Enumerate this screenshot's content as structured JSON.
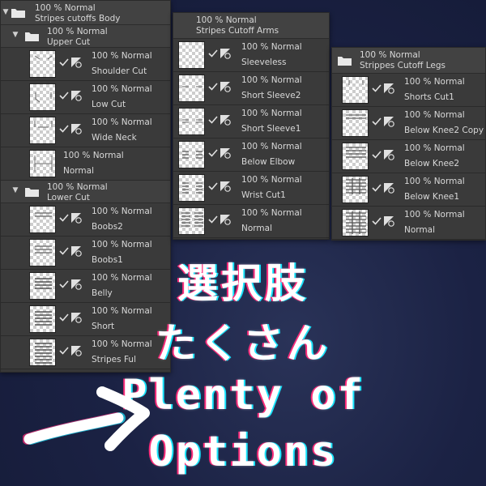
{
  "panel_body": {
    "group": {
      "blend": "100 % Normal",
      "name": "Stripes cutoffs Body"
    },
    "sub_upper": {
      "blend": "100 % Normal",
      "name": "Upper Cut"
    },
    "upper_layers": [
      {
        "blend": "100 % Normal",
        "name": "Shoulder Cut",
        "thumb_icon": "shoulder-cut-thumbnail"
      },
      {
        "blend": "100 % Normal",
        "name": "Low Cut",
        "thumb_icon": "low-cut-thumbnail"
      },
      {
        "blend": "100 % Normal",
        "name": "Wide Neck",
        "thumb_icon": "wide-neck-thumbnail"
      },
      {
        "blend": "100 % Normal",
        "name": "Normal",
        "thumb_icon": "normal-thumbnail"
      }
    ],
    "sub_lower": {
      "blend": "100 % Normal",
      "name": "Lower Cut"
    },
    "lower_layers": [
      {
        "blend": "100 % Normal",
        "name": "Boobs2",
        "thumb_icon": "boobs2-thumbnail"
      },
      {
        "blend": "100 % Normal",
        "name": "Boobs1",
        "thumb_icon": "boobs1-thumbnail"
      },
      {
        "blend": "100 % Normal",
        "name": "Belly",
        "thumb_icon": "belly-thumbnail"
      },
      {
        "blend": "100 % Normal",
        "name": "Short",
        "thumb_icon": "short-thumbnail"
      },
      {
        "blend": "100 % Normal",
        "name": "Stripes Ful",
        "thumb_icon": "stripes-full-thumbnail"
      }
    ]
  },
  "panel_arms": {
    "group": {
      "blend": "100 % Normal",
      "name": "Stripes Cutoff Arms"
    },
    "layers": [
      {
        "blend": "100 % Normal",
        "name": "Sleeveless"
      },
      {
        "blend": "100 % Normal",
        "name": "Short Sleeve2"
      },
      {
        "blend": "100 % Normal",
        "name": "Short Sleeve1"
      },
      {
        "blend": "100 % Normal",
        "name": "Below Elbow"
      },
      {
        "blend": "100 % Normal",
        "name": "Wrist Cut1"
      },
      {
        "blend": "100 % Normal",
        "name": "Normal"
      }
    ]
  },
  "panel_legs": {
    "group": {
      "blend": "100 % Normal",
      "name": "Strippes Cutoff Legs"
    },
    "layers": [
      {
        "blend": "100 % Normal",
        "name": "Shorts Cut1"
      },
      {
        "blend": "100 % Normal",
        "name": "Below Knee2 Copy"
      },
      {
        "blend": "100 % Normal",
        "name": "Below Knee2"
      },
      {
        "blend": "100 % Normal",
        "name": "Below Knee1"
      },
      {
        "blend": "100 % Normal",
        "name": "Normal"
      }
    ]
  },
  "overlay": {
    "jp_line1": "選択肢",
    "jp_line2": "たくさん",
    "en_line1": "Plenty of",
    "en_line2": "Options"
  },
  "icons": {
    "chevron": "chevron-down-icon",
    "folder": "folder-icon",
    "check": "visibility-check-icon",
    "mask": "layer-mask-icon",
    "arrow": "right-arrow-icon"
  },
  "colors": {
    "panel_bg": "#383838",
    "background": "#1b2244",
    "text": "#d8d8d8",
    "overlay_text": "#ffffff",
    "glitch_magenta": "#ff2b7a",
    "glitch_cyan": "#18e6ff"
  }
}
